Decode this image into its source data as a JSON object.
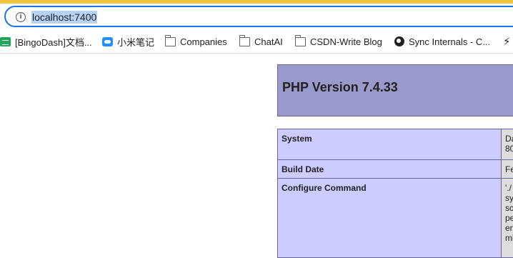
{
  "browser": {
    "url": "localhost:7400",
    "bookmarks": [
      {
        "label": "[BingoDash]文档...",
        "icon": "sheet-icon"
      },
      {
        "label": "小米笔记",
        "icon": "cloud-icon"
      },
      {
        "label": "Companies",
        "icon": "folder-icon"
      },
      {
        "label": "ChatAI",
        "icon": "folder-icon"
      },
      {
        "label": "CSDN-Write Blog",
        "icon": "folder-icon"
      },
      {
        "label": "Sync Internals - C...",
        "icon": "globe-icon"
      },
      {
        "label": "",
        "icon": "bolt-icon"
      }
    ]
  },
  "phpinfo": {
    "title": "PHP Version 7.4.33",
    "rows": [
      {
        "key": "System",
        "value": "Da\n80"
      },
      {
        "key": "Build Date",
        "value": "Fe"
      },
      {
        "key": "Configure Command",
        "value": "'./\nsys\nsc\npe\nen\nmb"
      }
    ]
  },
  "colors": {
    "accent": "#1a73e8",
    "php_header": "#9999cc",
    "php_key_cell": "#ccccff",
    "php_value_cell": "#dddddd"
  }
}
